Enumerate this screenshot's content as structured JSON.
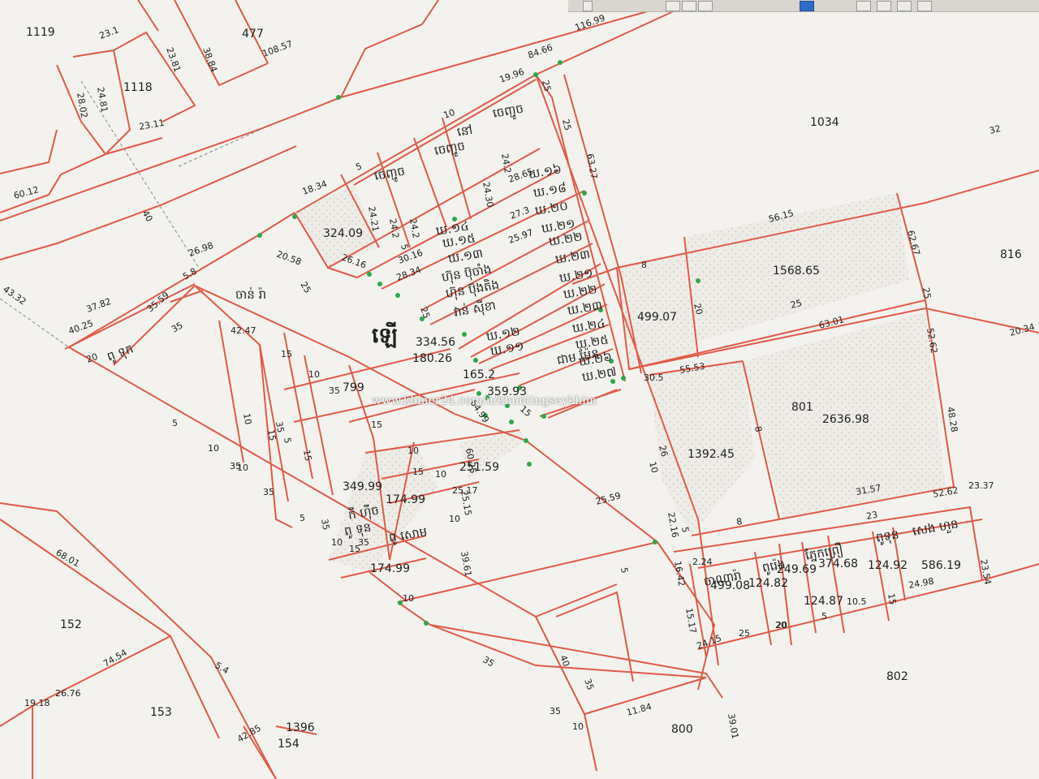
{
  "colors": {
    "boundary": "#e05a48",
    "paper": "#f3f2ee",
    "dot_fill": "#c9c6bf",
    "node": "#2da84a",
    "text": "#1f1f1f"
  },
  "watermark": "www.khmer24.com/u/khuntingseykhim",
  "big_label": "ឡើ",
  "parcels": [
    "1119",
    "1118",
    "477",
    "1034",
    "816",
    "799",
    "801",
    "802",
    "800",
    "152",
    "153",
    "154",
    "1396"
  ],
  "areas": [
    "324.09",
    "1568.65",
    "499.07",
    "334.56",
    "180.26",
    "165.2",
    "359.93",
    "1392.45",
    "2636.98",
    "251.59",
    "349.99",
    "174.99",
    "174.99",
    "499.08",
    "124.82",
    "249.69",
    "374.68",
    "124.87",
    "124.92",
    "586.19"
  ],
  "dims": [
    "23.1",
    "23.81",
    "24.81",
    "28.02",
    "23.11",
    "38.84",
    "108.57",
    "60.12",
    "40",
    "43.32",
    "37.82",
    "40.25",
    "20",
    "5.8",
    "35.59",
    "35",
    "26.98",
    "18.34",
    "20.58",
    "25",
    "19.96",
    "84.66",
    "116.99",
    "25",
    "25",
    "63.27",
    "10",
    "5",
    "24.2",
    "24.30",
    "28.65",
    "24.21",
    "24.2",
    "24.2",
    "27.3",
    "25.97",
    "26.16",
    "30.16",
    "28.34",
    "5",
    "25",
    "64.99",
    "15",
    "10",
    "26",
    "32",
    "56.15",
    "62.67",
    "25",
    "8",
    "20",
    "25",
    "63.01",
    "52.62",
    "20.34",
    "55.53",
    "30.5",
    "8",
    "48.28",
    "31.57",
    "52.62",
    "23.37",
    "8",
    "23",
    "5",
    "22.16",
    "16.42",
    "15.17",
    "24.15",
    "2.24",
    "20",
    "5",
    "10.5",
    "15",
    "24.98",
    "23.54",
    "25",
    "20",
    "5",
    "25.59",
    "39.61",
    "60.25",
    "25.15",
    "25.17",
    "10",
    "35",
    "40",
    "35",
    "35",
    "10",
    "11.84",
    "39.01",
    "68.01",
    "74.54",
    "26.76",
    "19.18",
    "5.4",
    "42.85",
    "42.47",
    "15",
    "10",
    "35",
    "15",
    "10",
    "5",
    "10",
    "10",
    "15",
    "35",
    "35",
    "5",
    "35",
    "10",
    "15",
    "10",
    "35",
    "15",
    "10",
    "10",
    "35",
    "5",
    "15"
  ],
  "owners": [
    "ចេញ្ជូច",
    "នៅ",
    "ចេញ្ជូច",
    "ចេញ្ជូច",
    "ចាន់ រ៉ា",
    "ពូ ទុក",
    "ហ៊ុន ប៊ុចាំង",
    "ហ៊ុន ប៊ុងតិង",
    "វាន់ ស៊ីខា",
    "ជាម ម៉ែន",
    "កី ហ៊ីច",
    "ពូ ទុន",
    "ពូ សោម",
    "ចាណារ៉ា",
    "ពូរ៉េង",
    "ភ្នែកព្រឿ",
    "ពូទុន",
    "សេង ហួន"
  ],
  "lots": [
    "ឃ.១៦",
    "ឃ.១៨",
    "ឃ.២០",
    "ឃ.២១",
    "ឃ.២២",
    "ឃ.២៣",
    "ឃ.២១",
    "ឃ.២២",
    "ឃ.២៣",
    "ឃ.២៤",
    "ឃ.២៥",
    "ឃ.២៦",
    "ឃ.២៧",
    "ឃ.១៤",
    "ឃ.១៥",
    "ឃ.១៣",
    "ឃ.១២",
    "ឃ.១១"
  ]
}
